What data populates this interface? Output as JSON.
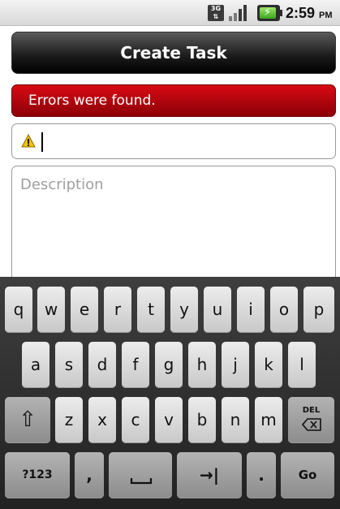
{
  "status_bar": {
    "network": "3G",
    "time": "2:59",
    "ampm": "PM"
  },
  "header": {
    "title": "Create Task"
  },
  "error_banner": {
    "message": "Errors were found."
  },
  "form": {
    "title_field": {
      "value": "",
      "placeholder": ""
    },
    "description_field": {
      "value": "",
      "placeholder": "Description"
    }
  },
  "keyboard": {
    "row1": [
      "q",
      "w",
      "e",
      "r",
      "t",
      "y",
      "u",
      "i",
      "o",
      "p"
    ],
    "row2": [
      "a",
      "s",
      "d",
      "f",
      "g",
      "h",
      "j",
      "k",
      "l"
    ],
    "row3_letters": [
      "z",
      "x",
      "c",
      "v",
      "b",
      "n",
      "m"
    ],
    "shift_label": "⇧",
    "del_label": "DEL",
    "symbols_label": "?123",
    "comma_label": ",",
    "space_label": "␣",
    "tab_label": "→|",
    "period_label": ".",
    "go_label": "Go"
  }
}
